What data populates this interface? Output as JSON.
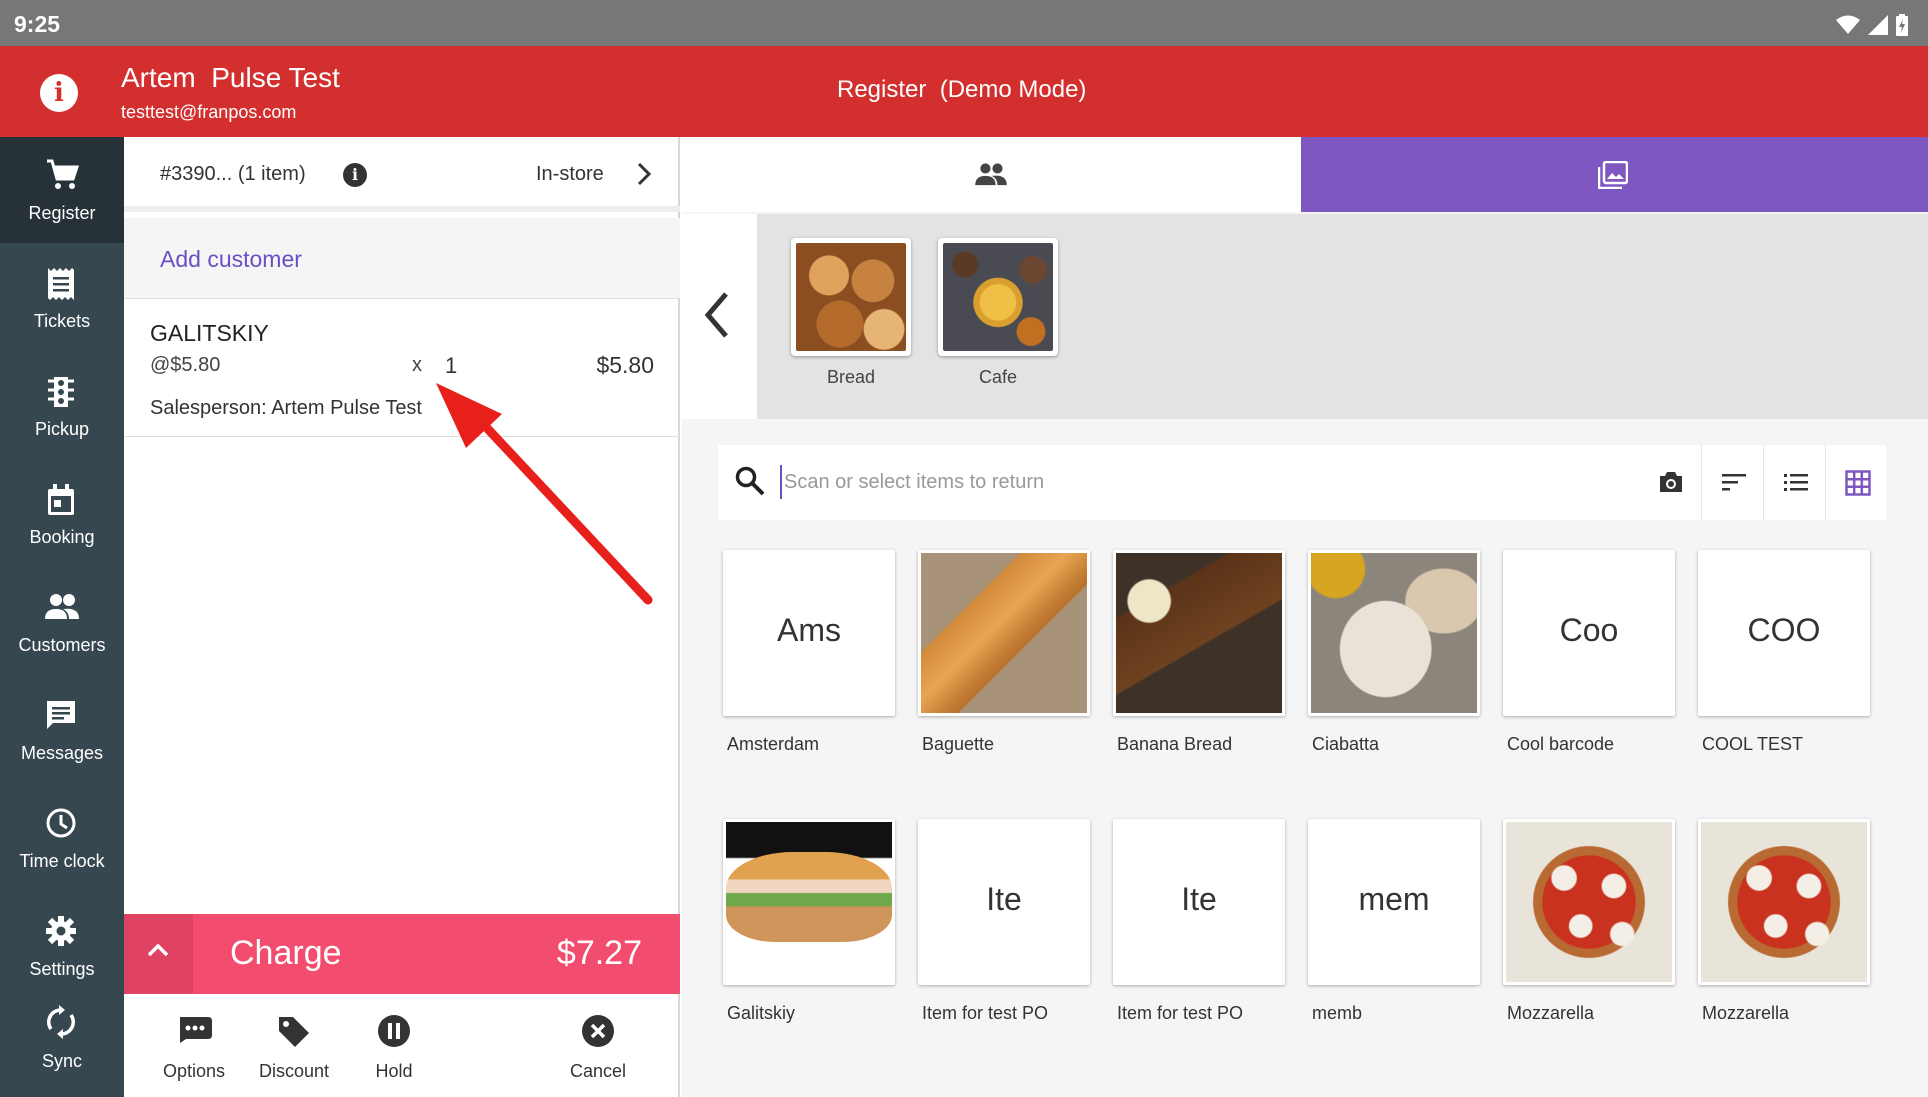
{
  "status_bar": {
    "time": "9:25",
    "wifi_icon": "wifi-icon",
    "signal_icon": "signal-icon",
    "battery_icon": "battery-icon"
  },
  "app_bar": {
    "account_name": "Artem  Pulse Test",
    "account_email": "testtest@franpos.com",
    "title": "Register  (Demo Mode)",
    "accent_color": "#d32f2f"
  },
  "nav": {
    "items": [
      {
        "label": "Register",
        "icon": "cart-icon",
        "active": true
      },
      {
        "label": "Tickets",
        "icon": "receipt-icon"
      },
      {
        "label": "Pickup",
        "icon": "traffic-light-icon"
      },
      {
        "label": "Booking",
        "icon": "calendar-icon"
      },
      {
        "label": "Customers",
        "icon": "people-icon"
      },
      {
        "label": "Messages",
        "icon": "message-icon"
      },
      {
        "label": "Time clock",
        "icon": "clock-icon"
      },
      {
        "label": "Settings",
        "icon": "gear-icon"
      },
      {
        "label": "Sync",
        "icon": "sync-icon"
      }
    ]
  },
  "ticket": {
    "number": "#3390... (1 item)",
    "order_type": "In-store",
    "add_customer": "Add customer",
    "line_item": {
      "name": "GALITSKIY",
      "unit_price": "@$5.80",
      "qty_x": "x",
      "qty": "1",
      "total": "$5.80",
      "salesperson": "Salesperson: Artem Pulse Test"
    },
    "charge": {
      "label": "Charge",
      "amount": "$7.27",
      "color": "#f24d6e"
    },
    "actions": [
      {
        "label": "Options",
        "icon": "options-icon"
      },
      {
        "label": "Discount",
        "icon": "tag-icon"
      },
      {
        "label": "Hold",
        "icon": "pause-icon"
      },
      {
        "label": "Cancel",
        "icon": "cancel-icon"
      }
    ]
  },
  "tabs": {
    "customers_icon": "people-icon",
    "images_icon": "image-icon",
    "active_color": "#7e57c2"
  },
  "categories": [
    {
      "name": "Bread"
    },
    {
      "name": "Cafe"
    }
  ],
  "search": {
    "placeholder": "Scan or select items to return",
    "tools": [
      "camera-icon",
      "sort-icon",
      "list-view-icon",
      "grid-view-icon"
    ]
  },
  "items": [
    {
      "name": "Amsterdam",
      "abbr": "Ams"
    },
    {
      "name": "Baguette",
      "abbr": ""
    },
    {
      "name": "Banana Bread",
      "abbr": ""
    },
    {
      "name": "Ciabatta",
      "abbr": ""
    },
    {
      "name": "Cool barcode",
      "abbr": "Coo"
    },
    {
      "name": "COOL TEST",
      "abbr": "COO"
    },
    {
      "name": "Galitskiy",
      "abbr": ""
    },
    {
      "name": "Item for test PO",
      "abbr": "Ite"
    },
    {
      "name": "Item for test PO",
      "abbr": "Ite"
    },
    {
      "name": "memb",
      "abbr": "mem"
    },
    {
      "name": "Mozzarella",
      "abbr": ""
    },
    {
      "name": "Mozzarella",
      "abbr": ""
    }
  ]
}
